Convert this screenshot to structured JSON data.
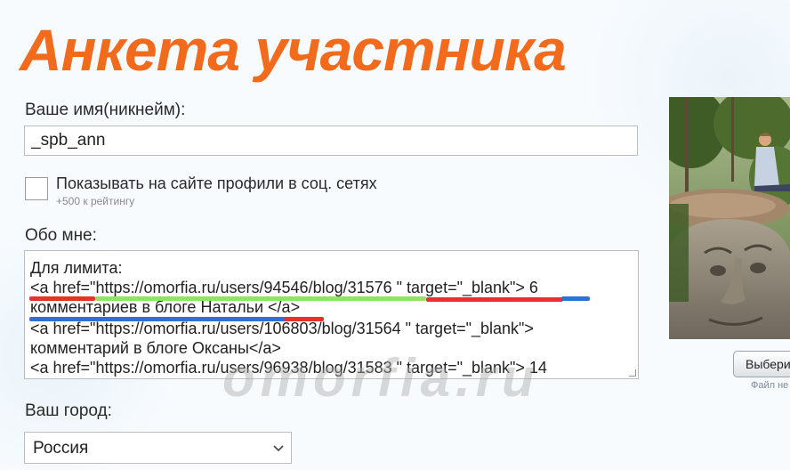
{
  "page": {
    "title": "Анкета участника",
    "watermark": "omorfia.ru"
  },
  "form": {
    "name_label": "Ваше имя(никнейм):",
    "name_value": "_spb_ann",
    "social_checkbox_label": "Показывать на сайте профили в соц. сетях",
    "social_checkbox_note": "+500 к рейтингу",
    "social_checkbox_checked": false,
    "about_label": "Обо мне:",
    "about_lines": [
      "Для лимита:",
      "<a href=\"https://omorfia.ru/users/94546/blog/31576 \" target=\"_blank\"> 6",
      "комментариев в блоге Натальи </a>",
      "<a href=\"https://omorfia.ru/users/106803/blog/31564 \" target=\"_blank\">",
      "комментарий в блоге Оксаны</a>",
      "<a href=\"https://omorfia.ru/users/96938/blog/31583 \" target=\"_blank\"> 14"
    ],
    "city_label": "Ваш город:",
    "city_value": "Россия"
  },
  "photo": {
    "choose_button": "Выберит",
    "no_file_text": "Файл не"
  },
  "colors": {
    "title": "#f26a1b",
    "highlight_red": "#e8312a",
    "highlight_green": "#8fe36a",
    "highlight_blue": "#2f6fd6"
  }
}
